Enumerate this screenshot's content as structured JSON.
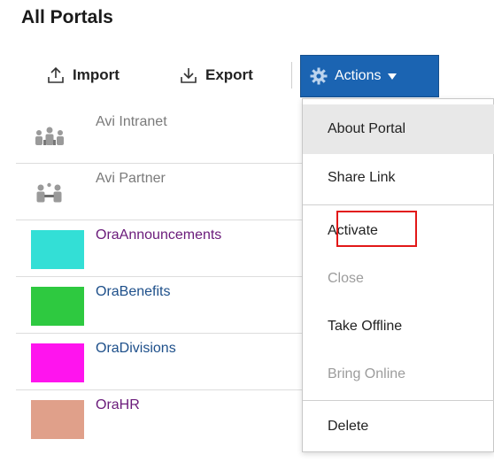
{
  "page": {
    "title": "All Portals"
  },
  "toolbar": {
    "import_label": "Import",
    "export_label": "Export",
    "actions_label": "Actions",
    "accent_color": "#1b64b2"
  },
  "portals": [
    {
      "name": "Avi Intranet",
      "thumb": "people-group-icon",
      "color": ""
    },
    {
      "name": "Avi Partner",
      "thumb": "people-partner-icon",
      "color": ""
    },
    {
      "name": "OraAnnouncements",
      "thumb": "color-swatch",
      "color": "#33dfd6"
    },
    {
      "name": "OraBenefits",
      "thumb": "color-swatch",
      "color": "#2ec940"
    },
    {
      "name": "OraDivisions",
      "thumb": "color-swatch",
      "color": "#ff14ee"
    },
    {
      "name": "OraHR",
      "thumb": "color-swatch",
      "color": "#e0a08a"
    }
  ],
  "actions_menu": {
    "items": [
      {
        "label": "About Portal",
        "state": "highlighted"
      },
      {
        "label": "Share Link",
        "state": "enabled"
      },
      {
        "label": "Activate",
        "state": "enabled"
      },
      {
        "label": "Close",
        "state": "disabled"
      },
      {
        "label": "Take Offline",
        "state": "enabled"
      },
      {
        "label": "Bring Online",
        "state": "disabled"
      },
      {
        "label": "Delete",
        "state": "enabled"
      }
    ]
  }
}
